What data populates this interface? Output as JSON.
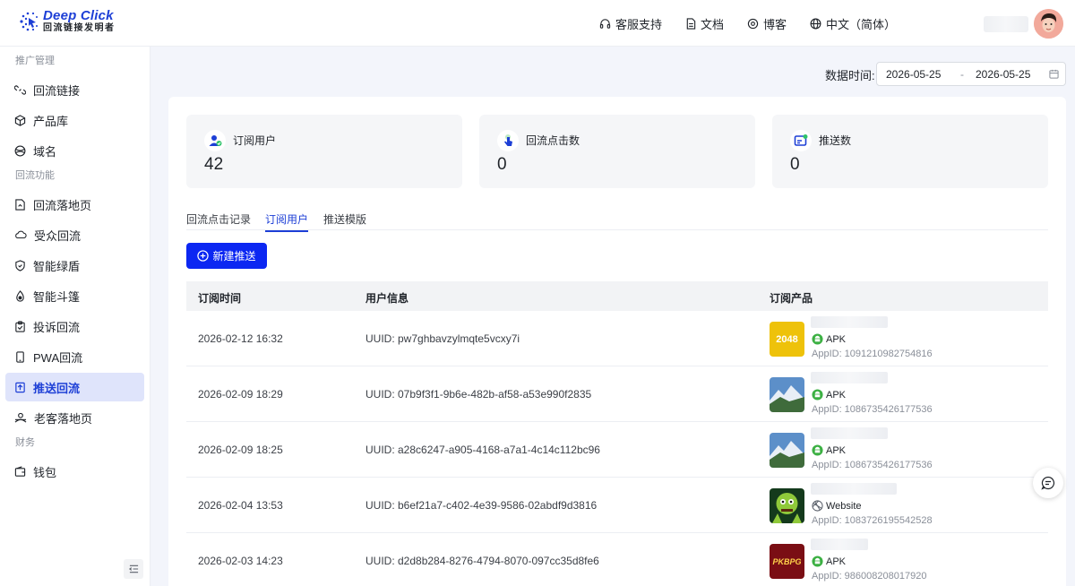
{
  "brand": {
    "title": "Deep Click",
    "subtitle": "回流链接发明者"
  },
  "topnav": [
    {
      "label": "客服支持",
      "icon": "headset-icon"
    },
    {
      "label": "文档",
      "icon": "document-icon"
    },
    {
      "label": "博客",
      "icon": "blog-icon"
    },
    {
      "label": "中文（简体）",
      "icon": "globe-icon"
    }
  ],
  "sidebar": {
    "groups": [
      {
        "title": "推广管理"
      },
      {
        "title": "回流功能"
      },
      {
        "title": "财务"
      }
    ],
    "items": [
      {
        "label": "回流链接",
        "icon": "link-icon"
      },
      {
        "label": "产品库",
        "icon": "box-icon"
      },
      {
        "label": "域名",
        "icon": "globe-icon"
      },
      {
        "label": "回流落地页",
        "icon": "landing-page-icon"
      },
      {
        "label": "受众回流",
        "icon": "cloud-icon"
      },
      {
        "label": "智能绿盾",
        "icon": "shield-icon"
      },
      {
        "label": "智能斗篷",
        "icon": "flame-icon"
      },
      {
        "label": "投诉回流",
        "icon": "clipboard-icon"
      },
      {
        "label": "PWA回流",
        "icon": "phone-icon"
      },
      {
        "label": "推送回流",
        "icon": "push-icon"
      },
      {
        "label": "老客落地页",
        "icon": "user-landing-icon"
      },
      {
        "label": "钱包",
        "icon": "wallet-icon"
      }
    ]
  },
  "date_filter": {
    "label": "数据时间:",
    "start": "2026-05-25",
    "separator": "-",
    "end": "2026-05-25"
  },
  "stats": [
    {
      "label": "订阅用户",
      "value": "42"
    },
    {
      "label": "回流点击数",
      "value": "0"
    },
    {
      "label": "推送数",
      "value": "0"
    }
  ],
  "tabs": [
    {
      "label": "回流点击记录"
    },
    {
      "label": "订阅用户",
      "active": true
    },
    {
      "label": "推送模版"
    }
  ],
  "new_button": "新建推送",
  "table": {
    "headers": [
      "订阅时间",
      "用户信息",
      "订阅产品"
    ],
    "rows": [
      {
        "time": "2026-02-12 16:32",
        "uuid": "UUID: pw7ghbavzylmqte5vcxy7i",
        "kind": "APK",
        "appid": "AppID: 1091210982754816",
        "thumb": "2048"
      },
      {
        "time": "2026-02-09 18:29",
        "uuid": "UUID: 07b9f3f1-9b6e-482b-af58-a53e990f2835",
        "kind": "APK",
        "appid": "AppID: 1086735426177536",
        "thumb": "mountain"
      },
      {
        "time": "2026-02-09 18:25",
        "uuid": "UUID: a28c6247-a905-4168-a7a1-4c14c112bc96",
        "kind": "APK",
        "appid": "AppID: 1086735426177536",
        "thumb": "mountain"
      },
      {
        "time": "2026-02-04 13:53",
        "uuid": "UUID: b6ef21a7-c402-4e39-9586-02abdf9d3816",
        "kind": "Website",
        "appid": "AppID: 1083726195542528",
        "thumb": "zombie"
      },
      {
        "time": "2026-02-03 14:23",
        "uuid": "UUID: d2d8b284-8276-4794-8070-097cc35d8fe6",
        "kind": "APK",
        "appid": "AppID: 986008208017920",
        "thumb": "pkbpg"
      }
    ]
  },
  "thumb_labels": {
    "game_2048": "2048",
    "pkbpg": "PKBPG"
  },
  "colors": {
    "accent": "#1d3fd6",
    "button": "#0c27f2",
    "apk_green": "#3cb043"
  }
}
